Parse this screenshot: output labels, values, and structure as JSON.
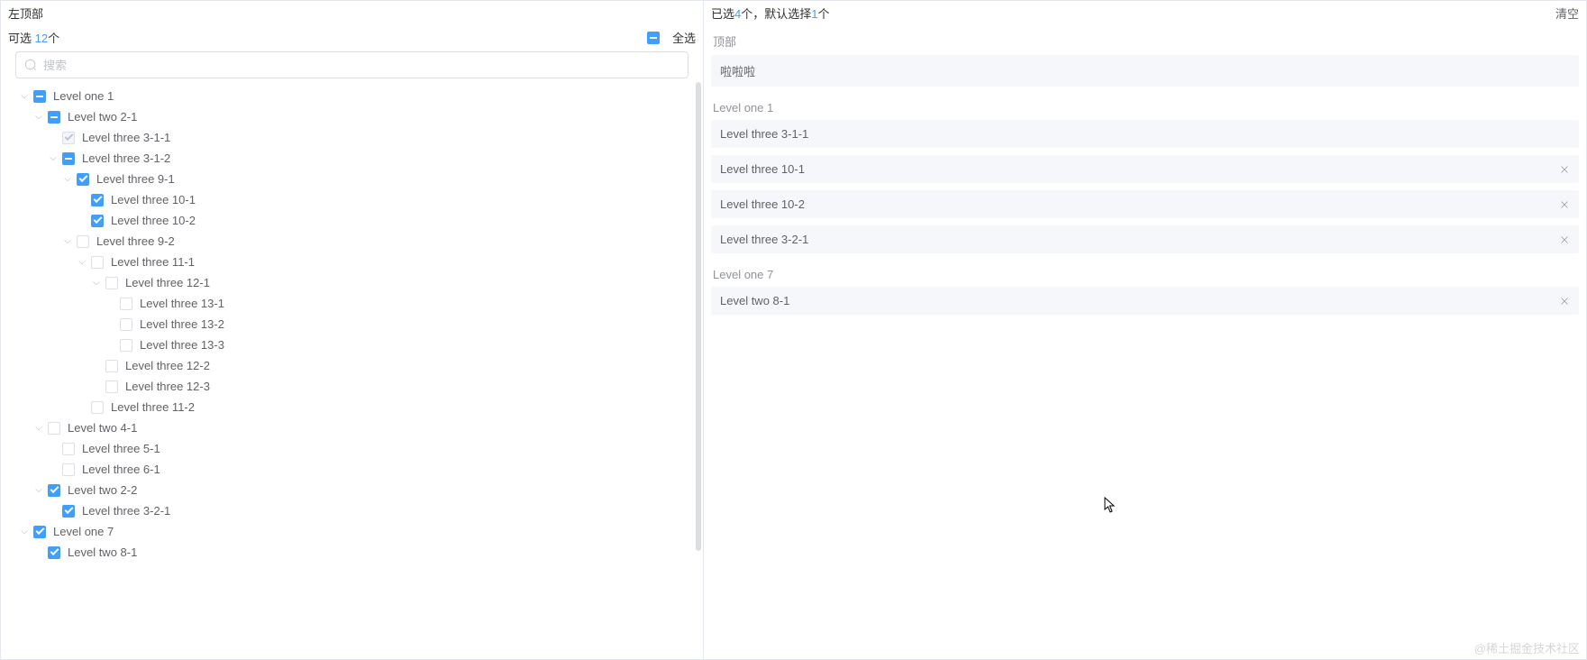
{
  "colors": {
    "primary": "#409eff"
  },
  "left": {
    "title": "左顶部",
    "selectable_prefix": "可选 ",
    "selectable_count": "12",
    "selectable_suffix": "个",
    "select_all_label": "全选",
    "search_placeholder": "搜索"
  },
  "tree_nodes": [
    {
      "indent": 0,
      "caret": "down",
      "check": "indeterminate",
      "label": "Level one 1"
    },
    {
      "indent": 1,
      "caret": "down",
      "check": "indeterminate",
      "label": "Level two 2-1"
    },
    {
      "indent": 2,
      "caret": "none",
      "check": "disabled-checked",
      "label": "Level three 3-1-1"
    },
    {
      "indent": 2,
      "caret": "down",
      "check": "indeterminate",
      "label": "Level three 3-1-2"
    },
    {
      "indent": 3,
      "caret": "down",
      "check": "checked",
      "label": "Level three 9-1"
    },
    {
      "indent": 4,
      "caret": "none",
      "check": "checked",
      "label": "Level three 10-1"
    },
    {
      "indent": 4,
      "caret": "none",
      "check": "checked",
      "label": "Level three 10-2"
    },
    {
      "indent": 3,
      "caret": "down",
      "check": "unchecked",
      "label": "Level three 9-2"
    },
    {
      "indent": 4,
      "caret": "down",
      "check": "unchecked",
      "label": "Level three 11-1"
    },
    {
      "indent": 5,
      "caret": "down",
      "check": "unchecked",
      "label": "Level three 12-1"
    },
    {
      "indent": 6,
      "caret": "none",
      "check": "unchecked",
      "label": "Level three 13-1"
    },
    {
      "indent": 6,
      "caret": "none",
      "check": "unchecked",
      "label": "Level three 13-2"
    },
    {
      "indent": 6,
      "caret": "none",
      "check": "unchecked",
      "label": "Level three 13-3"
    },
    {
      "indent": 5,
      "caret": "none",
      "check": "unchecked",
      "label": "Level three 12-2"
    },
    {
      "indent": 5,
      "caret": "none",
      "check": "unchecked",
      "label": "Level three 12-3"
    },
    {
      "indent": 4,
      "caret": "none",
      "check": "unchecked",
      "label": "Level three 11-2"
    },
    {
      "indent": 1,
      "caret": "down",
      "check": "unchecked",
      "label": "Level two 4-1"
    },
    {
      "indent": 2,
      "caret": "none",
      "check": "unchecked",
      "label": "Level three 5-1"
    },
    {
      "indent": 2,
      "caret": "none",
      "check": "unchecked",
      "label": "Level three 6-1"
    },
    {
      "indent": 1,
      "caret": "down",
      "check": "checked",
      "label": "Level two 2-2"
    },
    {
      "indent": 2,
      "caret": "none",
      "check": "checked",
      "label": "Level three 3-2-1"
    },
    {
      "indent": 0,
      "caret": "down",
      "check": "checked",
      "label": "Level one 7"
    },
    {
      "indent": 1,
      "caret": "none",
      "check": "checked",
      "label": "Level two 8-1"
    }
  ],
  "right": {
    "selected_prefix": "已选",
    "selected_count": "4",
    "selected_mid": "个，默认选择",
    "default_count": "1",
    "selected_suffix": "个",
    "clear_label": "清空",
    "groups": [
      {
        "label": "顶部",
        "items": [
          {
            "label": "啦啦啦",
            "removable": false
          }
        ]
      },
      {
        "label": "Level one 1",
        "items": [
          {
            "label": "Level three 3-1-1",
            "removable": false
          },
          {
            "label": "Level three 10-1",
            "removable": true
          },
          {
            "label": "Level three 10-2",
            "removable": true
          },
          {
            "label": "Level three 3-2-1",
            "removable": true
          }
        ]
      },
      {
        "label": "Level one 7",
        "items": [
          {
            "label": "Level two 8-1",
            "removable": true
          }
        ]
      }
    ]
  },
  "watermark": "@稀土掘金技术社区"
}
